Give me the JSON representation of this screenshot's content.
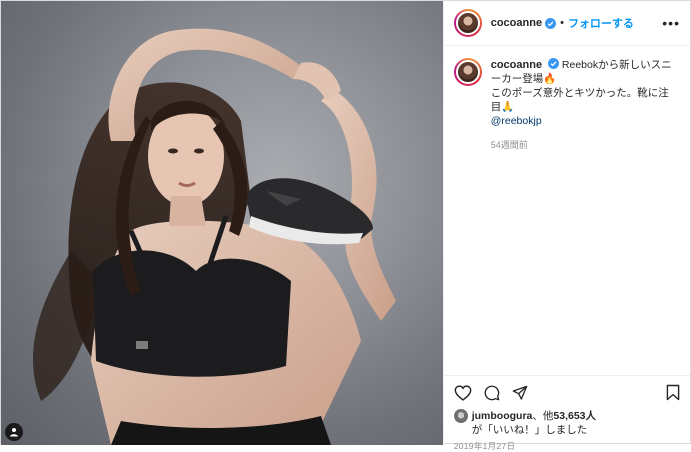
{
  "header": {
    "username": "cocoanne",
    "separator": "•",
    "follow_label": "フォローする",
    "more_label": "•••"
  },
  "caption": {
    "username": "cocoanne",
    "line1": "Reebokから新しいスニーカー登場🔥",
    "line2": "このポーズ意外とキツかった。靴に注目🙏",
    "mention": "@reebokjp",
    "time_ago": "54週間前"
  },
  "likes": {
    "first_liker": "jumboogura",
    "text_middle": "、他",
    "count": "53,653人",
    "text_end": "が「いいね！」しました"
  },
  "date": "2019年1月27日",
  "icons": {
    "heart": "heart-icon",
    "comment": "comment-icon",
    "share": "share-icon",
    "save": "bookmark-icon",
    "user_tag": "person-icon",
    "verified": "verified-badge-icon"
  },
  "colors": {
    "follow_blue": "#0095f6",
    "link": "#00376b",
    "muted": "#8e8e8e",
    "verified_blue": "#3897f0"
  }
}
